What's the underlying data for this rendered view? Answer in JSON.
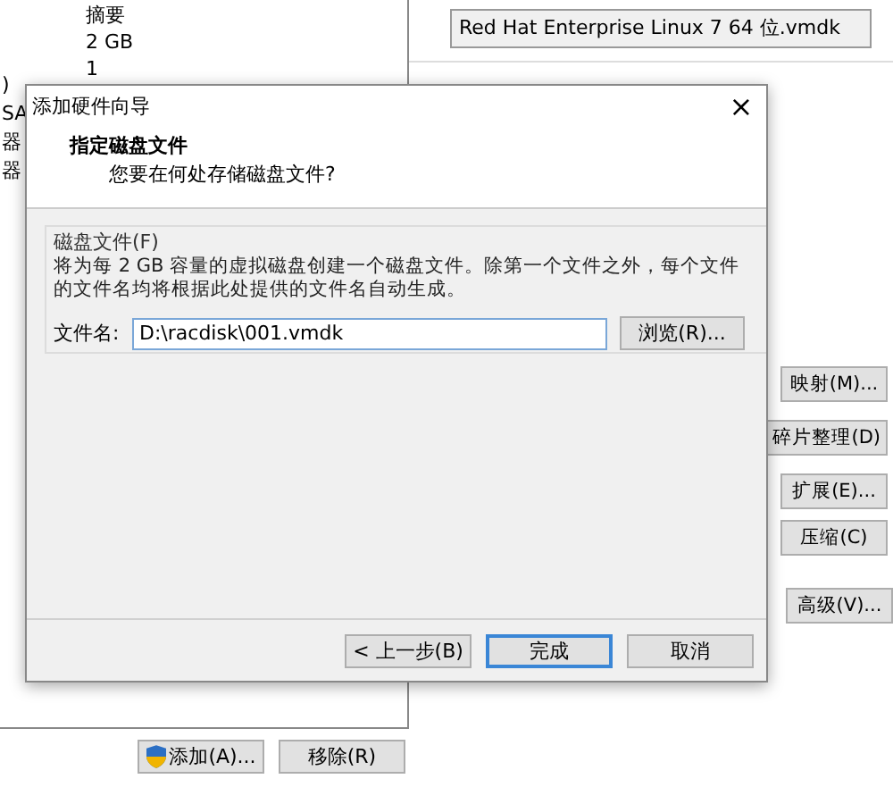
{
  "background": {
    "summary_header": "摘要",
    "summary_values": [
      "2 GB",
      "1"
    ],
    "left_edge_texts": [
      ")",
      "SA",
      "器",
      "器"
    ],
    "disk_file": "Red Hat Enterprise Linux 7 64 位.vmdk",
    "side_buttons": [
      {
        "label": "映射(M)..."
      },
      {
        "label": "碎片整理(D)"
      },
      {
        "label": "扩展(E)..."
      },
      {
        "label": "压缩(C)"
      },
      {
        "label": "高级(V)..."
      }
    ],
    "bottom_buttons": [
      {
        "label": "添加(A)...",
        "shield": true
      },
      {
        "label": "移除(R)",
        "shield": false
      }
    ]
  },
  "dialog": {
    "title": "添加硬件向导",
    "close": "×",
    "heading": "指定磁盘文件",
    "subheading": "您要在何处存储磁盘文件?",
    "group_label": "磁盘文件(F)",
    "description": "将为每 2 GB 容量的虚拟磁盘创建一个磁盘文件。除第一个文件之外，每个文件的文件名均将根据此处提供的文件名自动生成。",
    "file_label": "文件名:",
    "file_value": "D:\\racdisk\\001.vmdk",
    "browse": "浏览(R)...",
    "buttons": [
      {
        "label": "< 上一步(B)",
        "default": false
      },
      {
        "label": "完成",
        "default": true
      },
      {
        "label": "取消",
        "default": false
      }
    ]
  }
}
